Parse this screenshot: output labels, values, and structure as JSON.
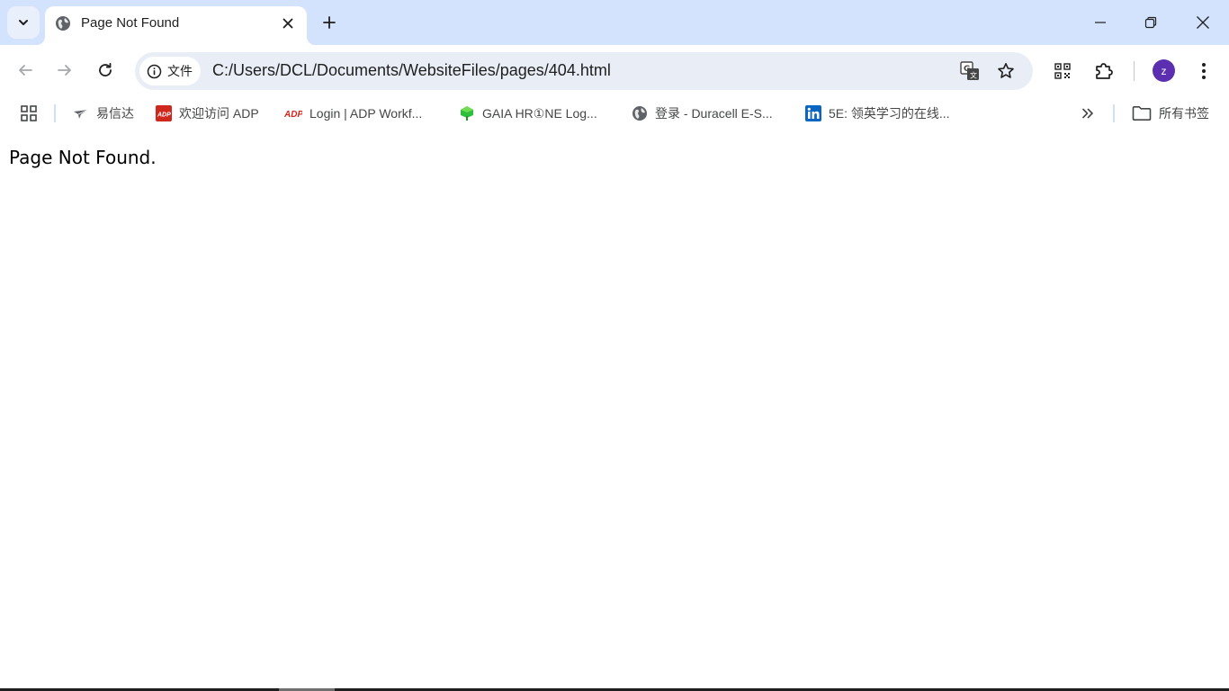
{
  "tab": {
    "title": "Page Not Found"
  },
  "omnibox": {
    "chip_label": "文件",
    "url": "C:/Users/DCL/Documents/WebsiteFiles/pages/404.html"
  },
  "profile": {
    "initial": "z",
    "color": "#5b2fb0"
  },
  "bookmarks": {
    "items": [
      {
        "label": "易信达",
        "icon": "paper-plane-icon"
      },
      {
        "label": "欢迎访问 ADP",
        "icon": "adp-logo-icon"
      },
      {
        "label": "Login | ADP Workf...",
        "icon": "adp-logo-icon"
      },
      {
        "label": "GAIA HR①NE Log...",
        "icon": "green-tree-icon"
      },
      {
        "label": "登录 - Duracell E-S...",
        "icon": "globe-icon"
      },
      {
        "label": "5E: 领英学习的在线...",
        "icon": "linkedin-icon"
      }
    ],
    "all_bookmarks_label": "所有书签"
  },
  "page": {
    "message": "Page Not Found."
  },
  "colors": {
    "tabstrip_bg": "#d3e3fd",
    "omnibox_bg": "#e9eef6",
    "adp_red": "#d0271d",
    "linkedin_blue": "#0a66c2"
  }
}
